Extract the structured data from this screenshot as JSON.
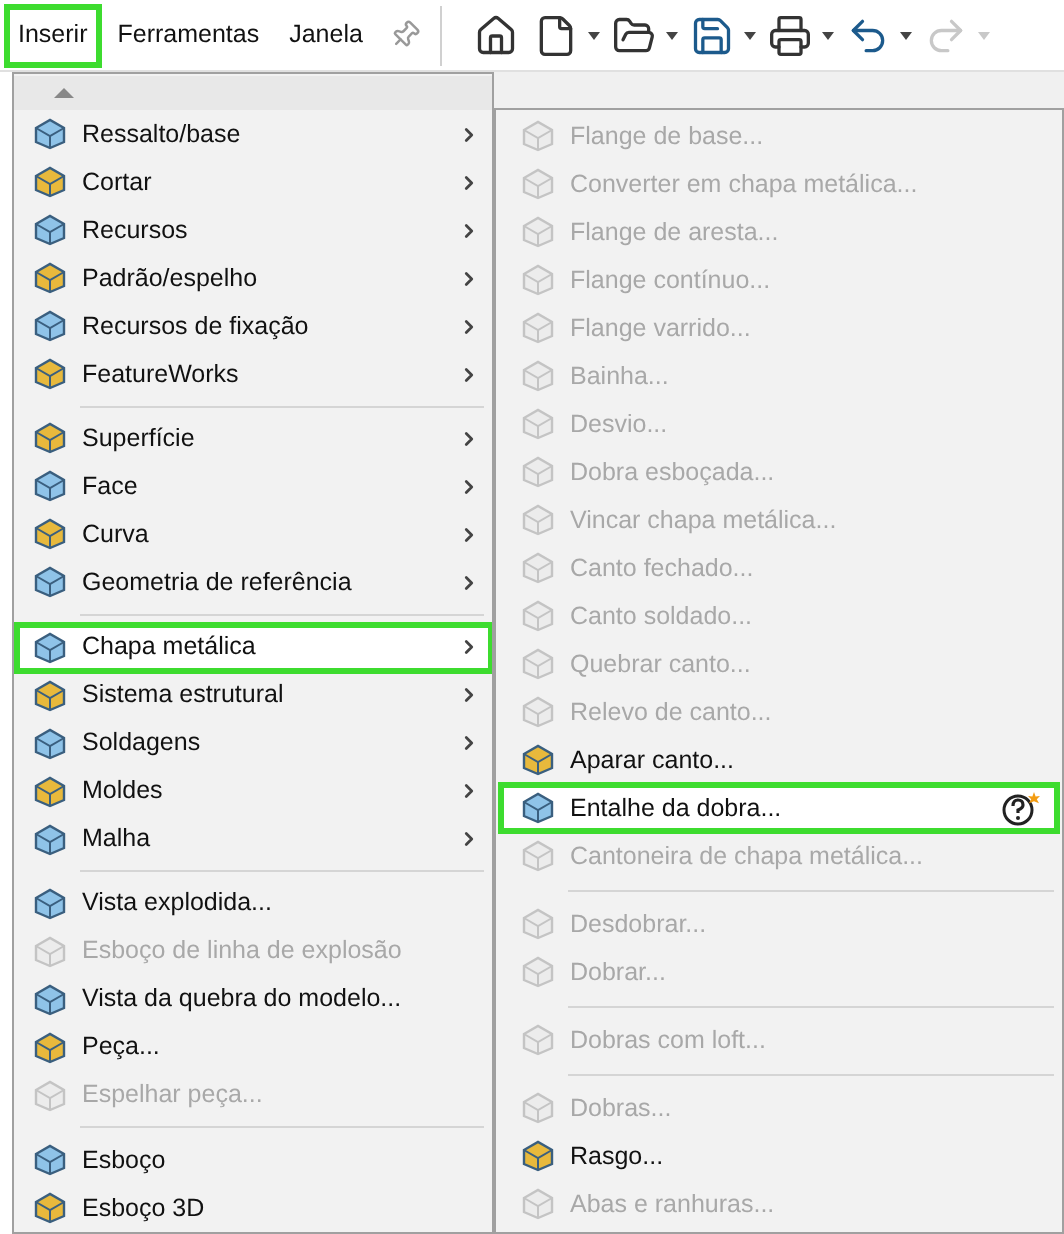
{
  "menu_bar": [
    {
      "label": "Inserir",
      "selected": true
    },
    {
      "label": "Ferramentas",
      "selected": false
    },
    {
      "label": "Janela",
      "selected": false
    }
  ],
  "toolbar": [
    {
      "disabled": false
    },
    {
      "disabled": false
    },
    {
      "disabled": false
    },
    {
      "disabled": false
    },
    {
      "disabled": false
    },
    {
      "disabled": false
    },
    {
      "disabled": true
    }
  ],
  "menu": [
    {
      "kind": "item",
      "label": "Ressalto/base",
      "submenu": true,
      "disabled": false,
      "selected": false
    },
    {
      "kind": "item",
      "label": "Cortar",
      "submenu": true,
      "disabled": false,
      "selected": false
    },
    {
      "kind": "item",
      "label": "Recursos",
      "submenu": true,
      "disabled": false,
      "selected": false
    },
    {
      "kind": "item",
      "label": "Padrão/espelho",
      "submenu": true,
      "disabled": false,
      "selected": false
    },
    {
      "kind": "item",
      "label": "Recursos de fixação",
      "submenu": true,
      "disabled": false,
      "selected": false
    },
    {
      "kind": "item",
      "label": "FeatureWorks",
      "submenu": true,
      "disabled": false,
      "selected": false
    },
    {
      "kind": "separator"
    },
    {
      "kind": "item",
      "label": "Superfície",
      "submenu": true,
      "disabled": false,
      "selected": false
    },
    {
      "kind": "item",
      "label": "Face",
      "submenu": true,
      "disabled": false,
      "selected": false
    },
    {
      "kind": "item",
      "label": "Curva",
      "submenu": true,
      "disabled": false,
      "selected": false
    },
    {
      "kind": "item",
      "label": "Geometria de referência",
      "submenu": true,
      "disabled": false,
      "selected": false
    },
    {
      "kind": "separator"
    },
    {
      "kind": "item",
      "label": "Chapa metálica",
      "submenu": true,
      "disabled": false,
      "selected": true
    },
    {
      "kind": "item",
      "label": "Sistema estrutural",
      "submenu": true,
      "disabled": false,
      "selected": false
    },
    {
      "kind": "item",
      "label": "Soldagens",
      "submenu": true,
      "disabled": false,
      "selected": false
    },
    {
      "kind": "item",
      "label": "Moldes",
      "submenu": true,
      "disabled": false,
      "selected": false
    },
    {
      "kind": "item",
      "label": "Malha",
      "submenu": true,
      "disabled": false,
      "selected": false
    },
    {
      "kind": "separator"
    },
    {
      "kind": "item",
      "label": "Vista explodida...",
      "submenu": false,
      "disabled": false,
      "selected": false
    },
    {
      "kind": "item",
      "label": "Esboço de linha de explosão",
      "submenu": false,
      "disabled": true,
      "selected": false
    },
    {
      "kind": "item",
      "label": "Vista da quebra do modelo...",
      "submenu": false,
      "disabled": false,
      "selected": false
    },
    {
      "kind": "item",
      "label": "Peça...",
      "submenu": false,
      "disabled": false,
      "selected": false
    },
    {
      "kind": "item",
      "label": "Espelhar peça...",
      "submenu": false,
      "disabled": true,
      "selected": false
    },
    {
      "kind": "separator"
    },
    {
      "kind": "item",
      "label": "Esboço",
      "submenu": false,
      "disabled": false,
      "selected": false
    },
    {
      "kind": "item",
      "label": "Esboço 3D",
      "submenu": false,
      "disabled": false,
      "selected": false
    }
  ],
  "submenu": [
    {
      "kind": "item",
      "label": "Flange de base...",
      "disabled": true,
      "selected": false
    },
    {
      "kind": "item",
      "label": "Converter em chapa metálica...",
      "disabled": true,
      "selected": false
    },
    {
      "kind": "item",
      "label": "Flange de aresta...",
      "disabled": true,
      "selected": false
    },
    {
      "kind": "item",
      "label": "Flange contínuo...",
      "disabled": true,
      "selected": false
    },
    {
      "kind": "item",
      "label": "Flange varrido...",
      "disabled": true,
      "selected": false
    },
    {
      "kind": "item",
      "label": "Bainha...",
      "disabled": true,
      "selected": false
    },
    {
      "kind": "item",
      "label": "Desvio...",
      "disabled": true,
      "selected": false
    },
    {
      "kind": "item",
      "label": "Dobra esboçada...",
      "disabled": true,
      "selected": false
    },
    {
      "kind": "item",
      "label": "Vincar chapa metálica...",
      "disabled": true,
      "selected": false
    },
    {
      "kind": "item",
      "label": "Canto fechado...",
      "disabled": true,
      "selected": false
    },
    {
      "kind": "item",
      "label": "Canto soldado...",
      "disabled": true,
      "selected": false
    },
    {
      "kind": "item",
      "label": "Quebrar canto...",
      "disabled": true,
      "selected": false
    },
    {
      "kind": "item",
      "label": "Relevo de canto...",
      "disabled": true,
      "selected": false
    },
    {
      "kind": "item",
      "label": "Aparar canto...",
      "disabled": false,
      "selected": false
    },
    {
      "kind": "item",
      "label": "Entalhe da dobra...",
      "disabled": false,
      "selected": true
    },
    {
      "kind": "item",
      "label": "Cantoneira de chapa metálica...",
      "disabled": true,
      "selected": false
    },
    {
      "kind": "separator"
    },
    {
      "kind": "item",
      "label": "Desdobrar...",
      "disabled": true,
      "selected": false
    },
    {
      "kind": "item",
      "label": "Dobrar...",
      "disabled": true,
      "selected": false
    },
    {
      "kind": "separator"
    },
    {
      "kind": "item",
      "label": "Dobras com loft...",
      "disabled": true,
      "selected": false
    },
    {
      "kind": "separator"
    },
    {
      "kind": "item",
      "label": "Dobras...",
      "disabled": true,
      "selected": false
    },
    {
      "kind": "item",
      "label": "Rasgo...",
      "disabled": false,
      "selected": false
    },
    {
      "kind": "item",
      "label": "Abas e ranhuras...",
      "disabled": true,
      "selected": false
    }
  ]
}
